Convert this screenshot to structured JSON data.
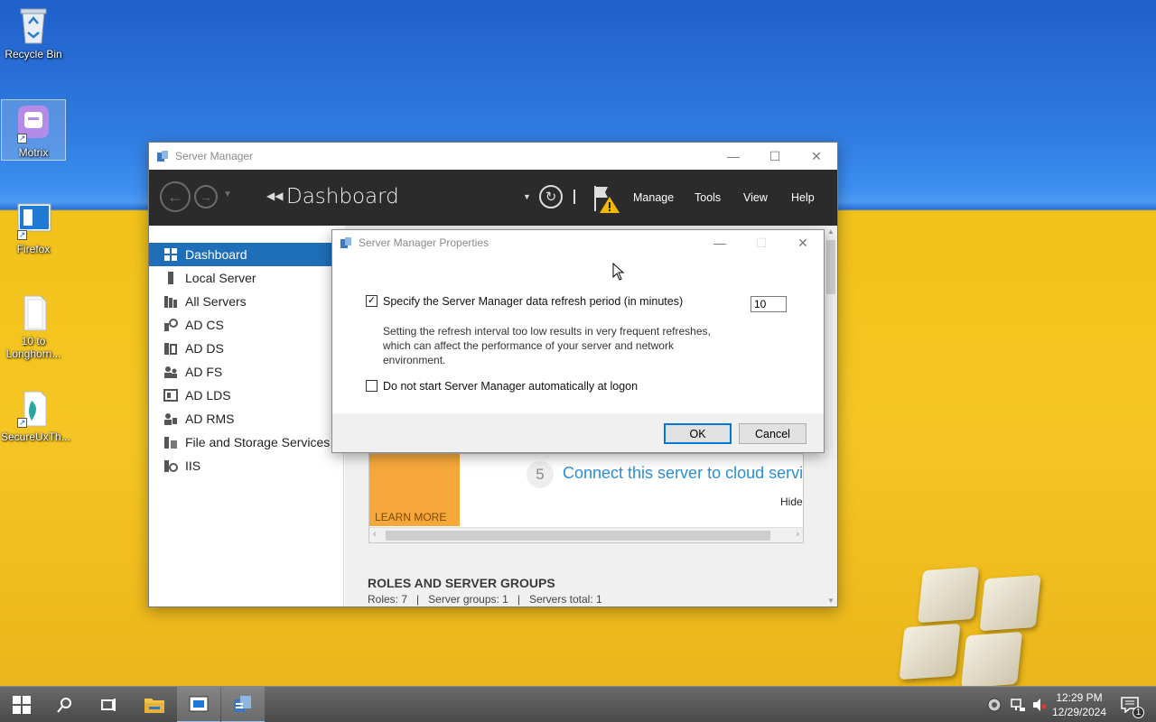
{
  "desktop": {
    "icons": [
      {
        "label": "Recycle Bin"
      },
      {
        "label": "Motrix"
      },
      {
        "label": "Firefox"
      },
      {
        "label": "10 to Longhorn..."
      },
      {
        "label": "SecureUxTh..."
      }
    ]
  },
  "server_manager": {
    "window_title": "Server Manager",
    "page_title": "Dashboard",
    "menu": [
      "Manage",
      "Tools",
      "View",
      "Help"
    ],
    "sidebar": [
      {
        "label": "Dashboard",
        "icon": "dashboard-icon"
      },
      {
        "label": "Local Server",
        "icon": "server-icon"
      },
      {
        "label": "All Servers",
        "icon": "servers-icon"
      },
      {
        "label": "AD CS",
        "icon": "adcs-icon"
      },
      {
        "label": "AD DS",
        "icon": "adds-icon"
      },
      {
        "label": "AD FS",
        "icon": "adfs-icon"
      },
      {
        "label": "AD LDS",
        "icon": "adlds-icon"
      },
      {
        "label": "AD RMS",
        "icon": "adrms-icon"
      },
      {
        "label": "File and Storage Services",
        "icon": "storage-icon"
      },
      {
        "label": "IIS",
        "icon": "iis-icon"
      }
    ],
    "welcome": {
      "learn_more": "LEARN MORE",
      "step_number": "5",
      "step_text": "Connect this server to cloud servic",
      "hide": "Hide"
    },
    "roles": {
      "heading": "ROLES AND SERVER GROUPS",
      "summary": "Roles: 7   |   Server groups: 1   |   Servers total: 1"
    }
  },
  "dialog": {
    "title": "Server Manager Properties",
    "refresh_checkbox_label": "Specify the Server Manager data refresh period (in minutes)",
    "refresh_checked": true,
    "refresh_value": "10",
    "warning_line1": "Setting the refresh interval too low results in very frequent refreshes,",
    "warning_line2": "which can affect the performance of your server and network",
    "warning_line3": "environment.",
    "logon_checkbox_label": "Do not start Server Manager automatically at logon",
    "logon_checked": false,
    "ok": "OK",
    "cancel": "Cancel"
  },
  "taskbar": {
    "time": "12:29 PM",
    "date": "12/29/2024",
    "notification_count": "1"
  },
  "colors": {
    "accent": "#1e6fb8",
    "header": "#2b2b2b",
    "learn_more_tile": "#f7a83a"
  }
}
